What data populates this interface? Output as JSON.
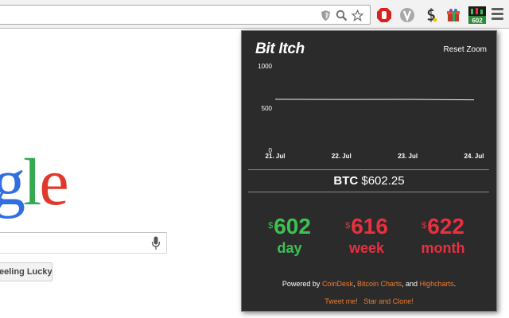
{
  "browser": {
    "extensions": [
      "shield-icon",
      "adblock-stop-icon",
      "vimium-icon",
      "coin-icon",
      "gift-icon",
      "bit-itch-extension-icon"
    ],
    "extension_badge": "602"
  },
  "google": {
    "logo_letters": [
      {
        "ch": "g",
        "color": "#2f6fe0"
      },
      {
        "ch": "l",
        "color": "#35a852"
      },
      {
        "ch": "e",
        "color": "#e0392b"
      }
    ],
    "lucky_label": "eeling Lucky"
  },
  "popup": {
    "title": "Bit Itch",
    "reset_zoom": "Reset Zoom",
    "price_symbol": "BTC",
    "price_value": "$602.25",
    "stats": [
      {
        "currency": "$",
        "value": "602",
        "label": "day",
        "color": "#3cc153"
      },
      {
        "currency": "$",
        "value": "616",
        "label": "week",
        "color": "#e8303f"
      },
      {
        "currency": "$",
        "value": "622",
        "label": "month",
        "color": "#e8303f"
      }
    ],
    "footer_prefix": "Powered by",
    "footer_links": [
      "CoinDesk",
      "Bitcoin Charts",
      "Highcharts"
    ],
    "footer_sep1": ",",
    "footer_sep2": ", and",
    "footer_end": ".",
    "tweet": "Tweet me!",
    "star": "Star and Clone!"
  },
  "chart_data": {
    "type": "line",
    "title": "",
    "xlabel": "",
    "ylabel": "",
    "x": [
      "21. Jul",
      "22. Jul",
      "23. Jul",
      "24. Jul"
    ],
    "series": [
      {
        "values": [
          605,
          603,
          604,
          598
        ]
      }
    ],
    "ylim": [
      0,
      1000
    ],
    "yticks": [
      0,
      500,
      1000
    ],
    "grid": false,
    "line_color": "#f5f5f5"
  }
}
